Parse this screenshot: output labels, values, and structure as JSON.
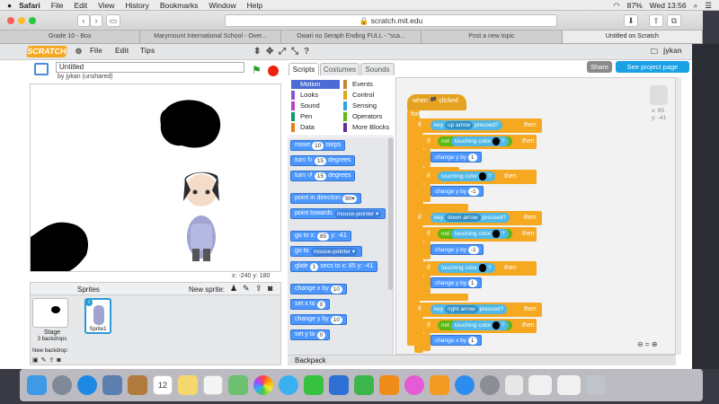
{
  "menubar": {
    "app": "Safari",
    "items": [
      "File",
      "Edit",
      "View",
      "History",
      "Bookmarks",
      "Window",
      "Help"
    ],
    "battery": "87%",
    "clock": "Wed 13:56"
  },
  "browser": {
    "url": "scratch.mit.edu",
    "tabs": [
      "Grade 10 - Box",
      "Marymount International School - Over...",
      "Owari no Seraph Ending FULL - \"sca...",
      "Post a new topic",
      "Untitled on Scratch"
    ]
  },
  "scratch": {
    "logo": "SCRATCH",
    "menus": [
      "File",
      "Edit",
      "Tips"
    ],
    "user": "jykan",
    "project_title": "Untitled",
    "byline": "by jykan (unshared)",
    "share": "Share",
    "see_project": "See project page",
    "coords": "x: -240  y: 180",
    "sprites_title": "Sprites",
    "new_sprite": "New sprite:",
    "stage_label": "Stage",
    "stage_sub": "3 backdrops",
    "new_backdrop": "New backdrop:",
    "sprite_name": "Sprite1",
    "sprite_info": "x: 85\ny: -41",
    "tabs": [
      "Scripts",
      "Costumes",
      "Sounds"
    ],
    "categories": [
      {
        "name": "Motion",
        "color": "#4a6cd4"
      },
      {
        "name": "Looks",
        "color": "#8a55d7"
      },
      {
        "name": "Sound",
        "color": "#bb42c3"
      },
      {
        "name": "Pen",
        "color": "#0e9a6c"
      },
      {
        "name": "Data",
        "color": "#ee7d16"
      },
      {
        "name": "Events",
        "color": "#c88330"
      },
      {
        "name": "Control",
        "color": "#e1a91a"
      },
      {
        "name": "Sensing",
        "color": "#2ca5e2"
      },
      {
        "name": "Operators",
        "color": "#5cb712"
      },
      {
        "name": "More Blocks",
        "color": "#632d99"
      }
    ],
    "palette": [
      {
        "text": "move",
        "val": "10",
        "after": "steps"
      },
      {
        "text": "turn ↻",
        "val": "15",
        "after": "degrees"
      },
      {
        "text": "turn ↺",
        "val": "15",
        "after": "degrees"
      },
      {
        "text": "point in direction",
        "val": "90▾",
        "after": ""
      },
      {
        "text": "point towards",
        "val": "mouse-pointer ▾",
        "after": ""
      },
      {
        "text": "go to x:",
        "val": "85",
        "after": "y: -41"
      },
      {
        "text": "go to",
        "val": "mouse-pointer ▾",
        "after": ""
      },
      {
        "text": "glide",
        "val": "1",
        "after": "secs to x: 85 y: -41"
      },
      {
        "text": "change x by",
        "val": "10",
        "after": ""
      },
      {
        "text": "set x to",
        "val": "0",
        "after": ""
      },
      {
        "text": "change y by",
        "val": "10",
        "after": ""
      },
      {
        "text": "set y to",
        "val": "0",
        "after": ""
      }
    ],
    "script": {
      "hat": "when 🏴 clicked",
      "forever": "forever",
      "if": "if",
      "then": "then",
      "key1": "up arrow",
      "key2": "down arrow",
      "key3": "right arrow",
      "pressed": "pressed?",
      "key_label": "key",
      "not": "not",
      "touching_color": "touching color",
      "q": "?",
      "change_y": "change y by",
      "change_x": "change x by",
      "v_up": "1",
      "v_neg": "-1",
      "v_x": "1"
    },
    "backpack": "Backpack",
    "zoom": "⊖ = ⊕"
  },
  "dock": [
    "Finder",
    "Launchpad",
    "Safari",
    "Preview",
    "Notes",
    "Calendar",
    "Stickies",
    "Reminders",
    "Maps",
    "Photos",
    "Messages",
    "FaceTime",
    "Keynote",
    "Numbers",
    "Pages",
    "iTunes",
    "iBooks",
    "App Store",
    "System Preferences"
  ]
}
